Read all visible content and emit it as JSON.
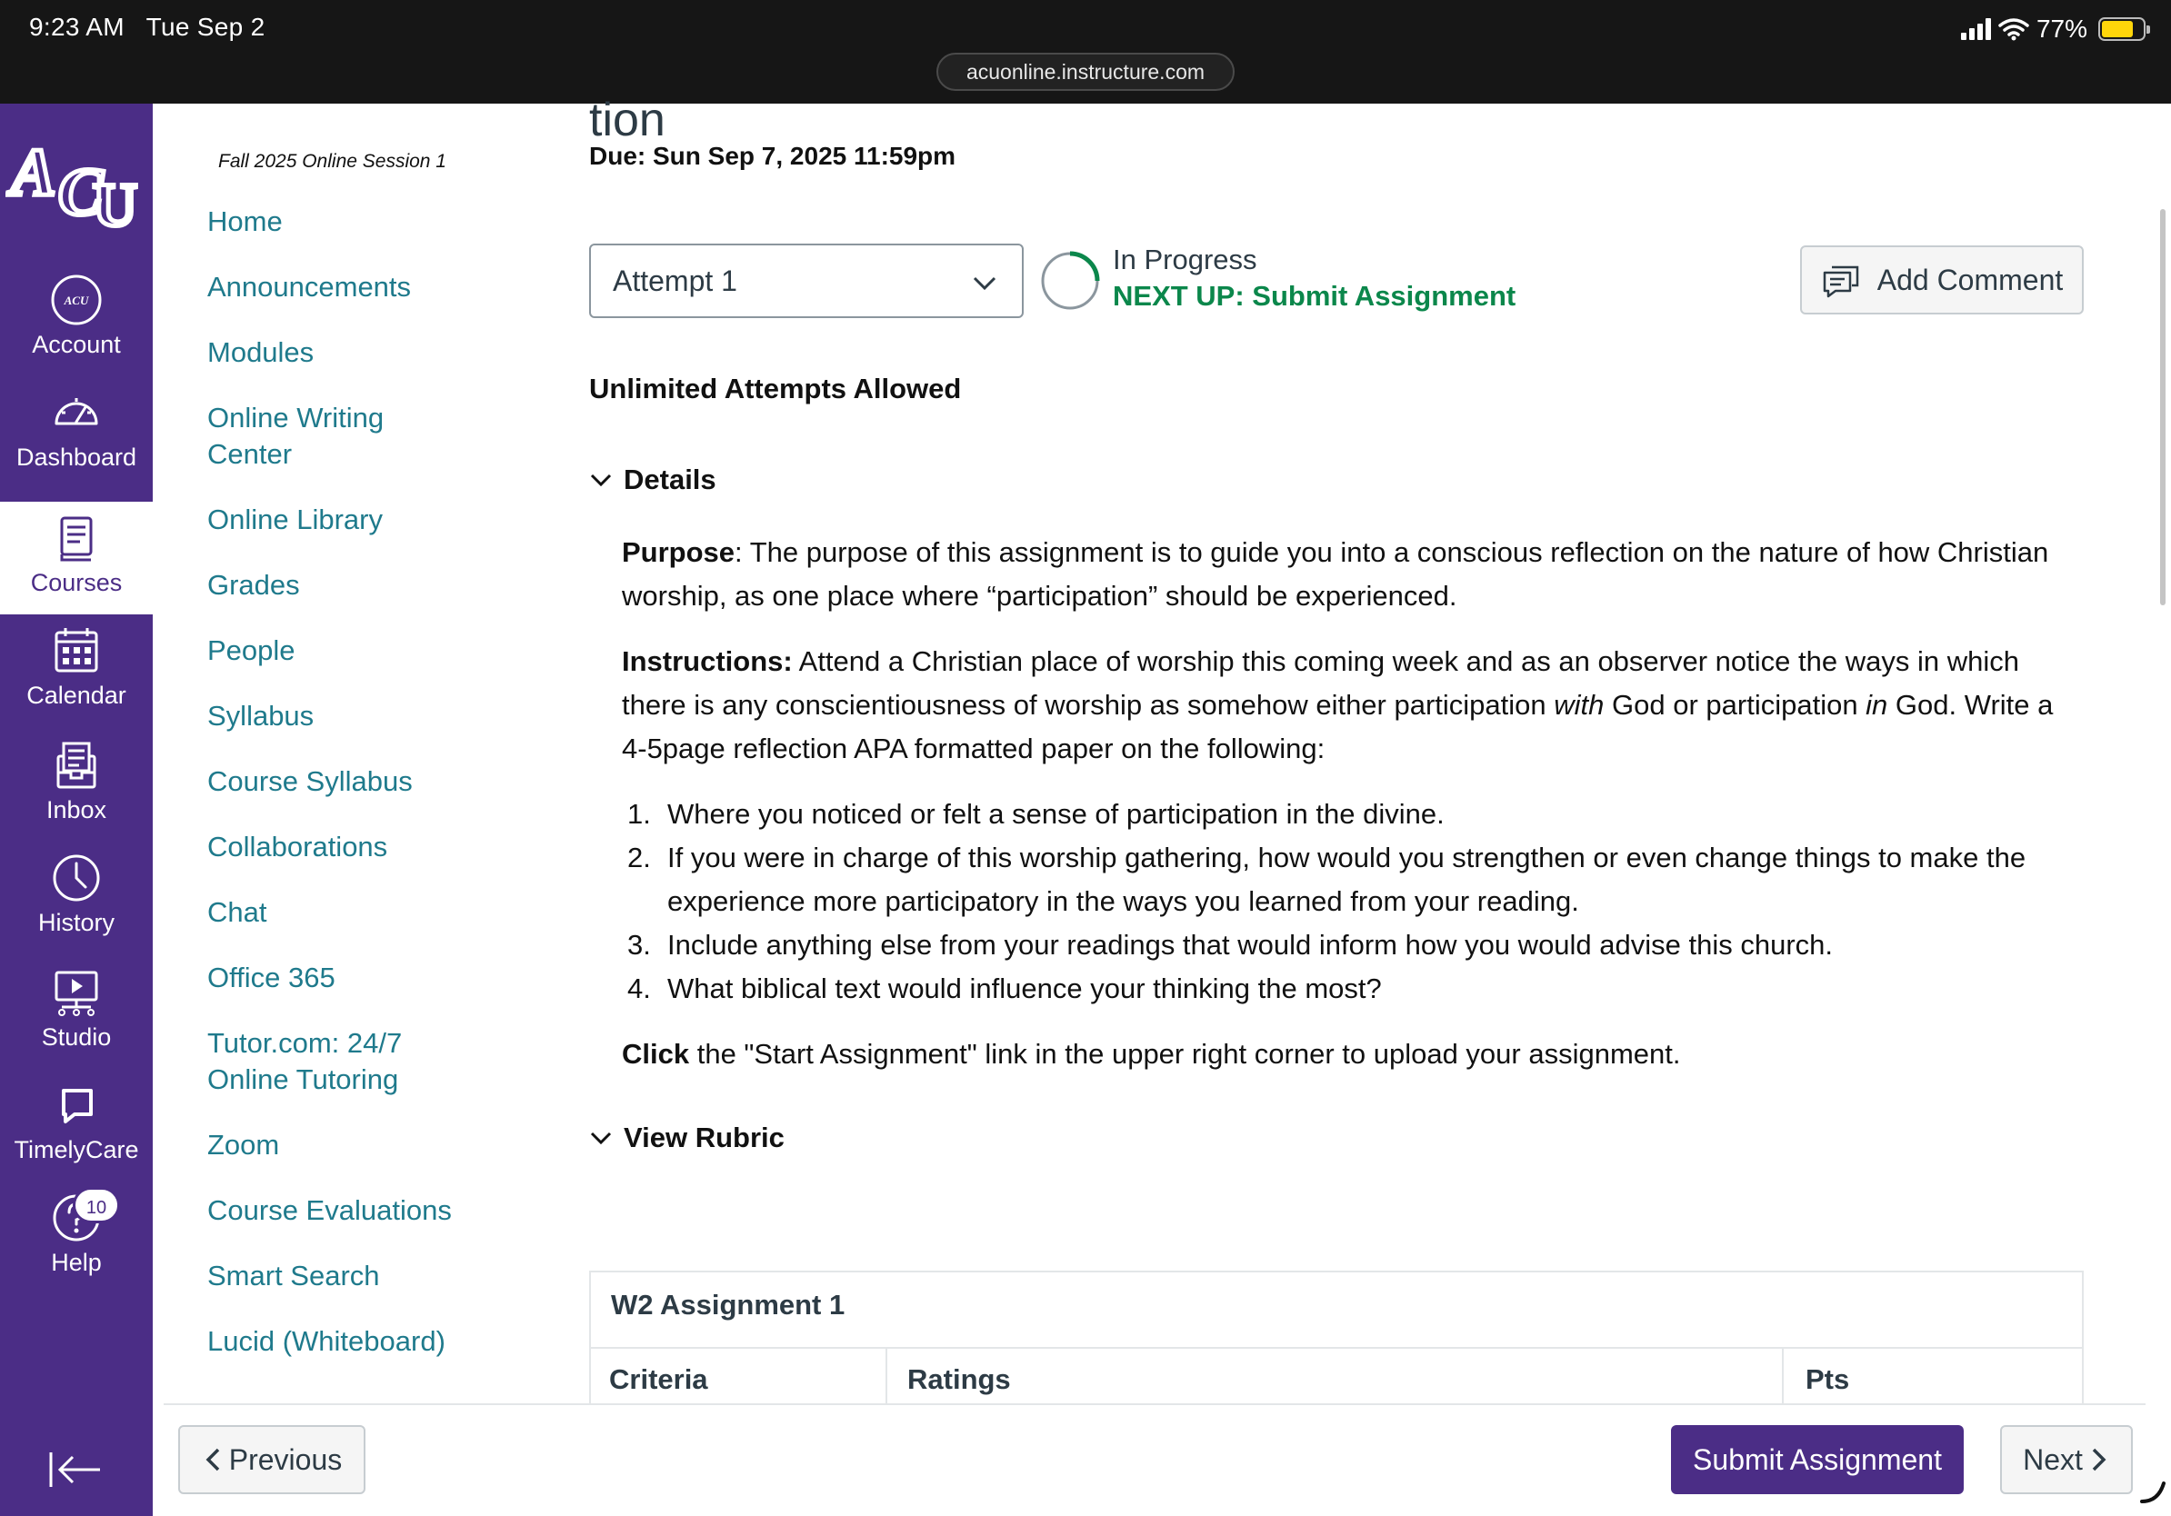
{
  "status_bar": {
    "time": "9:23 AM",
    "date": "Tue Sep 2",
    "url": "acuonline.instructure.com",
    "battery": "77%",
    "battery_level": 0.77,
    "signal_icon": "cellular-signal-icon",
    "wifi_icon": "wifi-icon"
  },
  "global_nav": {
    "logo_text": "ACU",
    "items": [
      {
        "label": "Account",
        "icon": "account-avatar-icon"
      },
      {
        "label": "Dashboard",
        "icon": "dashboard-gauge-icon"
      },
      {
        "label": "Courses",
        "icon": "courses-book-icon"
      },
      {
        "label": "Calendar",
        "icon": "calendar-icon"
      },
      {
        "label": "Inbox",
        "icon": "inbox-icon"
      },
      {
        "label": "History",
        "icon": "clock-icon"
      },
      {
        "label": "Studio",
        "icon": "studio-icon"
      },
      {
        "label": "TimelyCare",
        "icon": "chat-bubble-icon"
      },
      {
        "label": "Help",
        "icon": "help-icon",
        "badge": "10"
      }
    ],
    "active": "Courses",
    "collapse_icon": "collapse-nav-icon"
  },
  "course_nav": {
    "term": "Fall 2025 Online Session 1",
    "items": [
      "Home",
      "Announcements",
      "Modules",
      "Online Writing Center",
      "Online Library",
      "Grades",
      "People",
      "Syllabus",
      "Course Syllabus",
      "Collaborations",
      "Chat",
      "Office 365",
      "Tutor.com: 24/7 Online Tutoring",
      "Zoom",
      "Course Evaluations",
      "Smart Search",
      "Lucid (Whiteboard)"
    ]
  },
  "assignment": {
    "title_fragment": "tion",
    "due": "Due: Sun Sep 7, 2025 11:59pm",
    "attempt_select": "Attempt 1",
    "status": "In Progress",
    "next_up": "NEXT UP: Submit Assignment",
    "add_comment": "Add Comment",
    "attempts_allowed": "Unlimited Attempts Allowed",
    "details_toggle": "Details",
    "purpose_label": "Purpose",
    "purpose_text": ": The purpose of this assignment is to guide you into a conscious reflection on the nature of how Christian worship, as one place where “participation” should be experienced.",
    "instructions_label": "Instructions:",
    "instructions_text_1": " Attend a Christian place of worship this coming week and as an observer notice the ways in which there is any conscientiousness of worship as somehow either participation ",
    "instructions_em_1": "with",
    "instructions_text_2": " God or participation ",
    "instructions_em_2": "in",
    "instructions_text_3": " God. Write a 4-5page reflection APA formatted paper on the following:",
    "list": [
      "Where you noticed or felt a sense of participation in the divine.",
      "If you were in charge of this worship gathering, how would you strengthen or even change things to make the experience more participatory in the ways you learned from your reading.",
      "Include anything else from your readings that would inform how you would advise this church.",
      "What biblical text would influence your thinking the most?"
    ],
    "list_numbers": [
      "1.",
      "2.",
      "3.",
      "4."
    ],
    "click_label": "Click",
    "click_text": " the \"Start Assignment\" link in the upper right corner to upload your assignment.",
    "rubric_toggle": "View Rubric",
    "rubric": {
      "title": "W2 Assignment 1",
      "columns": [
        "Criteria",
        "Ratings",
        "Pts"
      ]
    }
  },
  "footer": {
    "previous": "Previous",
    "submit": "Submit Assignment",
    "next": "Next"
  },
  "colors": {
    "brand_purple": "#4b2d86",
    "link_teal": "#1f7a8c",
    "success_green": "#0b874b"
  }
}
